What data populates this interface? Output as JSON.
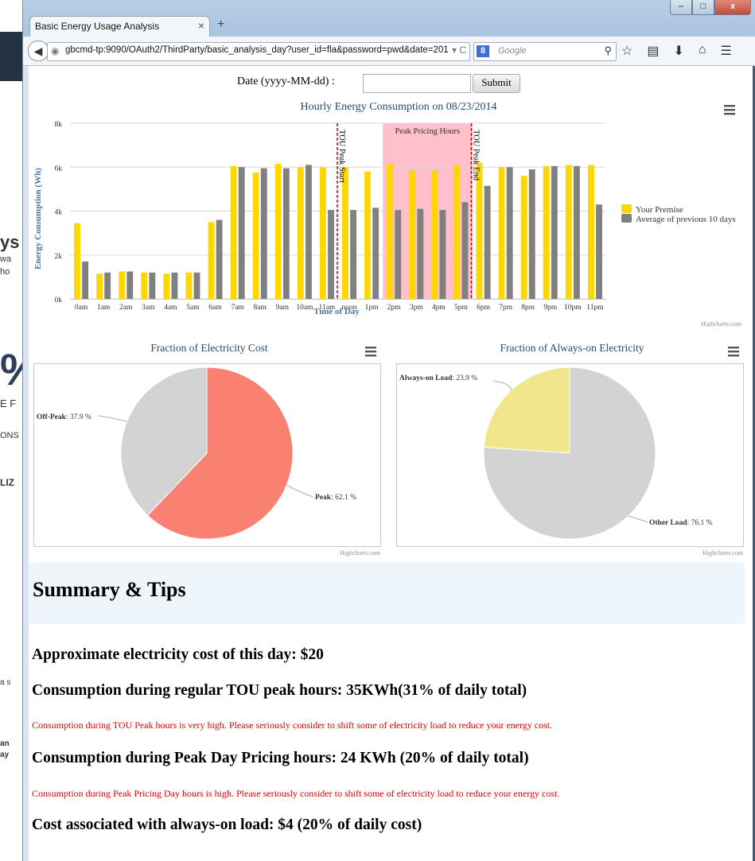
{
  "background": {
    "fragments": [
      "ys",
      "wa",
      "ho",
      "%",
      "E F",
      "ONS",
      "LIZ",
      "a s",
      "an",
      "ay"
    ]
  },
  "browser": {
    "tab_title": "Basic Energy Usage Analysis",
    "tab_close": "×",
    "new_tab": "+",
    "url": "gbcmd-tp:9090/OAuth2/ThirdParty/basic_analysis_day?user_id=fla&password=pwd&date=201",
    "search_placeholder": "Google",
    "search_engine_glyph": "8",
    "minimize": "–",
    "maximize": "□",
    "close": "x"
  },
  "form": {
    "date_label": "Date (yyyy-MM-dd) :",
    "date_value": "",
    "submit_label": "Submit"
  },
  "colors": {
    "premise": "#FFD700",
    "average": "#808080",
    "peak_band": "#FFC0CB",
    "tou_line": "#CC0000",
    "peak_slice": "#FA8072",
    "offpeak_slice": "#D3D3D3",
    "alwayson_slice": "#F0E68C",
    "other_slice": "#D3D3D3"
  },
  "chart_data": [
    {
      "type": "bar",
      "title": "Hourly Energy Consumption on 08/23/2014",
      "xlabel": "Time of Day",
      "ylabel": "Energy Consumption (Wh)",
      "ylim": [
        0,
        8000
      ],
      "yticks": [
        "0k",
        "2k",
        "4k",
        "6k",
        "8k"
      ],
      "categories": [
        "0am",
        "1am",
        "2am",
        "3am",
        "4am",
        "5am",
        "6am",
        "7am",
        "8am",
        "9am",
        "10am",
        "11am",
        "noon",
        "1pm",
        "2pm",
        "3pm",
        "4pm",
        "5pm",
        "6pm",
        "7pm",
        "8pm",
        "9pm",
        "10pm",
        "11pm"
      ],
      "series": [
        {
          "name": "Your Premise",
          "values": [
            3450,
            1150,
            1250,
            1200,
            1150,
            1200,
            3500,
            6050,
            5750,
            6150,
            6000,
            6000,
            6000,
            5800,
            6150,
            5850,
            5850,
            6100,
            6200,
            6000,
            5600,
            6050,
            6100,
            6100
          ]
        },
        {
          "name": "Average of previous 10 days",
          "values": [
            1700,
            1200,
            1250,
            1200,
            1200,
            1200,
            3600,
            6000,
            5950,
            5950,
            6100,
            4050,
            4050,
            4150,
            4050,
            4100,
            4050,
            4400,
            5150,
            6000,
            5900,
            6050,
            6050,
            4300
          ]
        }
      ],
      "plot_bands": [
        {
          "from": "2pm",
          "to": "5pm",
          "label": "Peak Pricing Hours"
        }
      ],
      "plot_lines": [
        {
          "label": "TOU Peak Start"
        },
        {
          "label": "TOU Peak End"
        }
      ],
      "legend": "right",
      "credits": "Highcharts.com",
      "grid": true
    },
    {
      "type": "pie",
      "title": "Fraction of Electricity Cost",
      "slices": [
        {
          "name": "Peak",
          "value": 62.1,
          "label": ": 62.1 %"
        },
        {
          "name": "Off-Peak",
          "value": 37.9,
          "label": ": 37.9 %"
        }
      ],
      "credits": "Highcharts.com"
    },
    {
      "type": "pie",
      "title": "Fraction of Always-on Electricity",
      "slices": [
        {
          "name": "Always-on Load",
          "value": 23.9,
          "label": ": 23.9 %"
        },
        {
          "name": "Other Load",
          "value": 76.1,
          "label": ": 76.1 %"
        }
      ],
      "credits": "Highcharts.com"
    }
  ],
  "summary": {
    "title": "Summary & Tips",
    "cost_line": "Approximate electricity cost of this day: $20",
    "tou_line": "Consumption during regular TOU peak hours: 35KWh(31% of daily total)",
    "tou_warning": "Consumption during TOU Peak hours is very high. Please seriously consider to shift some of electricity load to reduce your energy cost.",
    "peakday_line": "Consumption during Peak Day Pricing hours: 24 KWh (20% of daily total)",
    "peakday_warning": "Consumption during Peak Pricing Day hours is high. Please seriously consider to shift some of electricity load to reduce your energy cost.",
    "alwayson_line": "Cost associated with always-on load: $4 (20% of daily cost)"
  }
}
